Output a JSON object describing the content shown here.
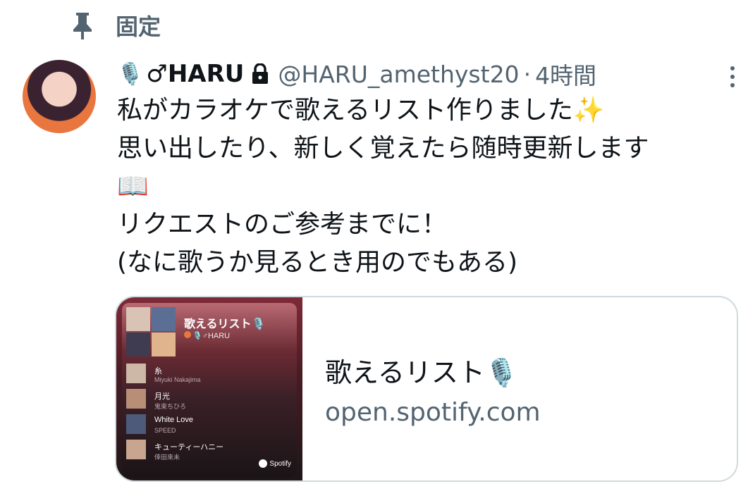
{
  "pinned": {
    "label": "固定"
  },
  "tweet": {
    "mic_emoji": "🎙️",
    "display_name": "♂HARU",
    "handle": "@HARU_amethyst20",
    "separator": "·",
    "time": "4時間",
    "lines": [
      "私がカラオケで歌えるリスト作りました✨",
      "思い出したり、新しく覚えたら随時更新します",
      "📖",
      "リクエストのご参考までに！",
      "(なに歌うか見るとき用のでもある)"
    ]
  },
  "card": {
    "title": "歌えるリスト🎙️",
    "domain": "open.spotify.com",
    "thumbnail": {
      "playlist_title": "歌えるリスト🎙️",
      "owner": "🎙️♂HARU",
      "tracks": [
        {
          "name": "糸",
          "artist": "Miyuki Nakajima"
        },
        {
          "name": "月光",
          "artist": "鬼束ちひろ"
        },
        {
          "name": "White Love",
          "artist": "SPEED"
        },
        {
          "name": "キューティーハニー",
          "artist": "倖田來未"
        }
      ],
      "brand": "Spotify"
    }
  },
  "colors": {
    "secondary_text": "#536471",
    "border": "#cfd9de"
  },
  "icons": [
    "pin-icon",
    "lock-icon",
    "more-icon"
  ]
}
